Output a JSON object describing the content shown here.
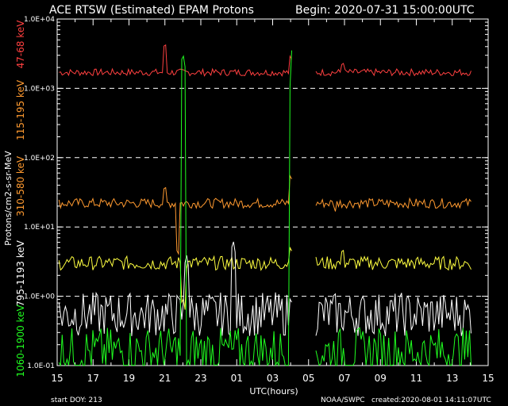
{
  "chart_data": {
    "type": "line",
    "title": "ACE RTSW (Estimated) EPAM Protons",
    "begin_label": "Begin: 2020-07-31 15:00:00UTC",
    "xlabel": "UTC(hours)",
    "ylabel": "Protons/cm2-s-sr-MeV",
    "yscale": "log",
    "ylim": [
      0.1,
      10000
    ],
    "xlim": [
      0,
      24
    ],
    "grid": false,
    "x_ticks": [
      "15",
      "17",
      "19",
      "21",
      "23",
      "01",
      "03",
      "05",
      "07",
      "09",
      "11",
      "13",
      "15"
    ],
    "y_ticks": [
      "1.0E-01",
      "1.0E+00",
      "1.0E+01",
      "1.0E+02",
      "1.0E+03",
      "1.0E+04"
    ],
    "dashed_reference_lines": [
      1.0,
      10.0,
      100.0,
      1000.0
    ],
    "data_gap": [
      13.1,
      14.4
    ],
    "series": [
      {
        "name": "47-68 keV",
        "color": "#ff4040",
        "base": 1700,
        "noise": 0.05,
        "spikes": [
          [
            6.0,
            4800
          ],
          [
            13.0,
            3200
          ],
          [
            15.9,
            2600
          ]
        ]
      },
      {
        "name": "115-195 keV",
        "color": "#ff9a30",
        "base": 0,
        "noise": 0,
        "spikes": []
      },
      {
        "name": "310-580 keV",
        "color": "#ff9a30",
        "base": 22,
        "noise": 0.07,
        "spikes": [
          [
            6.0,
            42
          ],
          [
            6.7,
            5.0
          ],
          [
            13.0,
            60
          ],
          [
            15.6,
            25
          ]
        ]
      },
      {
        "name": "795-1193 keV",
        "color": "#ffff40",
        "base": 3.0,
        "noise": 0.1,
        "spikes": [
          [
            7.0,
            1.0
          ],
          [
            13.0,
            5.5
          ],
          [
            15.9,
            5.2
          ]
        ]
      },
      {
        "name": "1060-1900 keV",
        "color": "#ffffff",
        "base": 0.55,
        "noise": 0.32,
        "spikes": [
          [
            7.2,
            4.0
          ],
          [
            9.8,
            6.5
          ],
          [
            13.0,
            1.0
          ]
        ]
      },
      {
        "name": "",
        "color": "#20ff20",
        "base": 0.16,
        "noise": 0.35,
        "spikes": [
          [
            7.0,
            3200
          ],
          [
            7.3,
            0.12
          ],
          [
            13.05,
            1400
          ],
          [
            13.1,
            4000
          ]
        ]
      }
    ],
    "axis_label_colors": {
      "47-68 keV": "#ff4040",
      "115-195 keV": "#ff9a30",
      "310-580 keV": "#ff9a30",
      "795-1193 keV": "#ffff40",
      "1060-1900 keV": "#20ff20"
    }
  },
  "footer": {
    "start_doy": "start DOY:  213",
    "source": "NOAA/SWPC",
    "created": "created:2020-08-01 14:11:07UTC"
  }
}
